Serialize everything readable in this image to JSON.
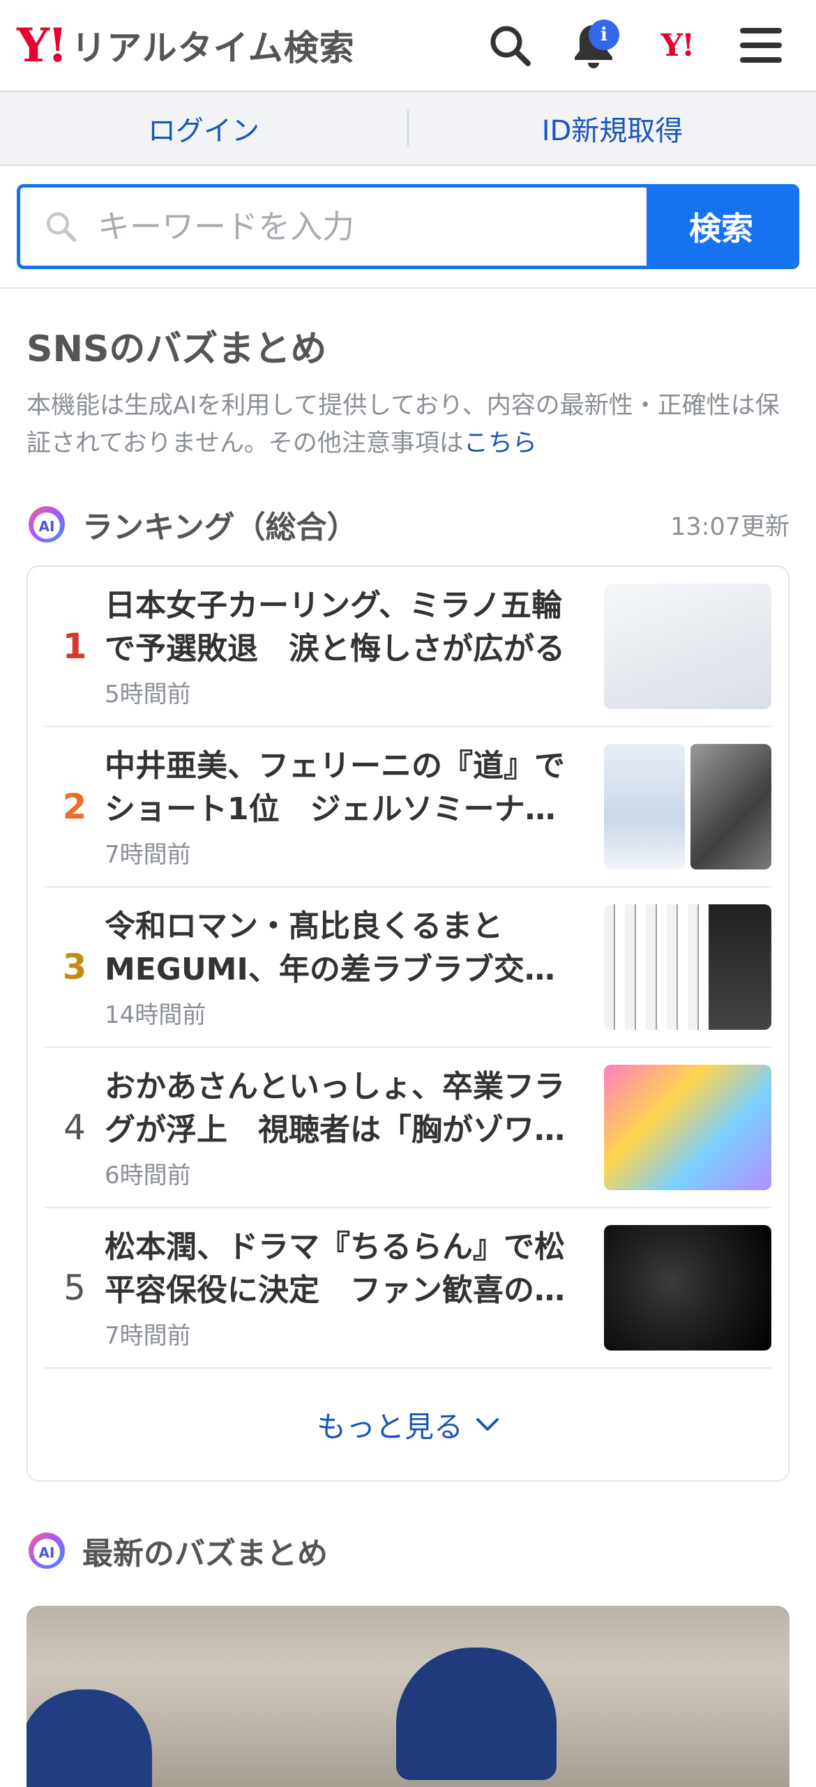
{
  "header": {
    "logo_mark": "Y!",
    "logo_text": "リアルタイム検索",
    "notif_badge": "i",
    "yj_mark": "Y!"
  },
  "login_bar": {
    "login": "ログイン",
    "register": "ID新規取得"
  },
  "search": {
    "placeholder": "キーワードを入力",
    "button": "検索"
  },
  "section": {
    "title": "SNSのバズまとめ",
    "notice_text": "本機能は生成AIを利用して提供しており、内容の最新性・正確性は保証されておりません。その他注意事項は",
    "notice_link": "こちら"
  },
  "ranking": {
    "badge": "AI",
    "title": "ランキング（総合）",
    "updated": "13:07更新",
    "items": [
      {
        "rank": "1",
        "title": "日本女子カーリング、ミラノ五輪で予選敗退　涙と悔しさが広がる",
        "time": "5時間前"
      },
      {
        "rank": "2",
        "title": "中井亜美、フェリーニの『道』でショート1位　ジェルソミーナ…",
        "time": "7時間前"
      },
      {
        "rank": "3",
        "title": "令和ロマン・髙比良くるまとMEGUMI、年の差ラブラブ交…",
        "time": "14時間前"
      },
      {
        "rank": "4",
        "title": "おかあさんといっしょ、卒業フラグが浮上　視聴者は「胸がゾワ…",
        "time": "6時間前"
      },
      {
        "rank": "5",
        "title": "松本潤、ドラマ『ちるらん』で松平容保役に決定　ファン歓喜の…",
        "time": "7時間前"
      }
    ],
    "more": "もっと見る"
  },
  "latest": {
    "badge": "AI",
    "title": "最新のバズまとめ"
  },
  "colors": {
    "brand_red": "#e6002d",
    "link_blue": "#1a56b8",
    "search_blue": "#1673ef",
    "badge_blue": "#3568e8"
  }
}
